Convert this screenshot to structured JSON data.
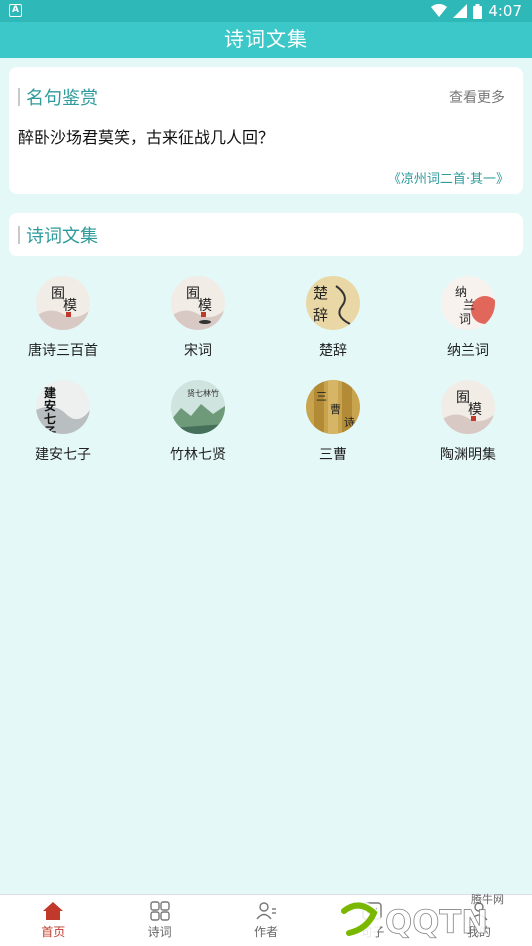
{
  "status_bar": {
    "time": "4:07"
  },
  "header": {
    "title": "诗词文集"
  },
  "quote_card": {
    "title": "名句鉴赏",
    "more_label": "查看更多",
    "quote": "醉卧沙场君莫笑，古来征战几人回？",
    "source": "《凉州词二首·其一》"
  },
  "collection_card": {
    "title": "诗词文集"
  },
  "collections": [
    {
      "label": "唐诗三百首",
      "icon": "ink-cover-icon"
    },
    {
      "label": "宋词",
      "icon": "ink-cover-icon"
    },
    {
      "label": "楚辞",
      "icon": "calligraphy-cover-icon"
    },
    {
      "label": "纳兰词",
      "icon": "calligraphy-cover-icon"
    },
    {
      "label": "建安七子",
      "icon": "calligraphy-cover-icon"
    },
    {
      "label": "竹林七贤",
      "icon": "landscape-cover-icon"
    },
    {
      "label": "三曹",
      "icon": "bamboo-cover-icon"
    },
    {
      "label": "陶渊明集",
      "icon": "ink-cover-icon"
    }
  ],
  "tabs": [
    {
      "label": "首页",
      "icon": "home-icon",
      "active": true
    },
    {
      "label": "诗词",
      "icon": "grid-icon",
      "active": false
    },
    {
      "label": "作者",
      "icon": "person-icon",
      "active": false
    },
    {
      "label": "句子",
      "icon": "sentence-icon",
      "active": false
    },
    {
      "label": "我的",
      "icon": "profile-icon",
      "active": false
    }
  ],
  "colors": {
    "primary": "#3cc8c8",
    "accent_text": "#2e9a9a",
    "active_tab": "#c0392b",
    "background": "#e4f8f8"
  },
  "watermark": {
    "brand": "QQTN",
    "sub": "腾牛网"
  }
}
